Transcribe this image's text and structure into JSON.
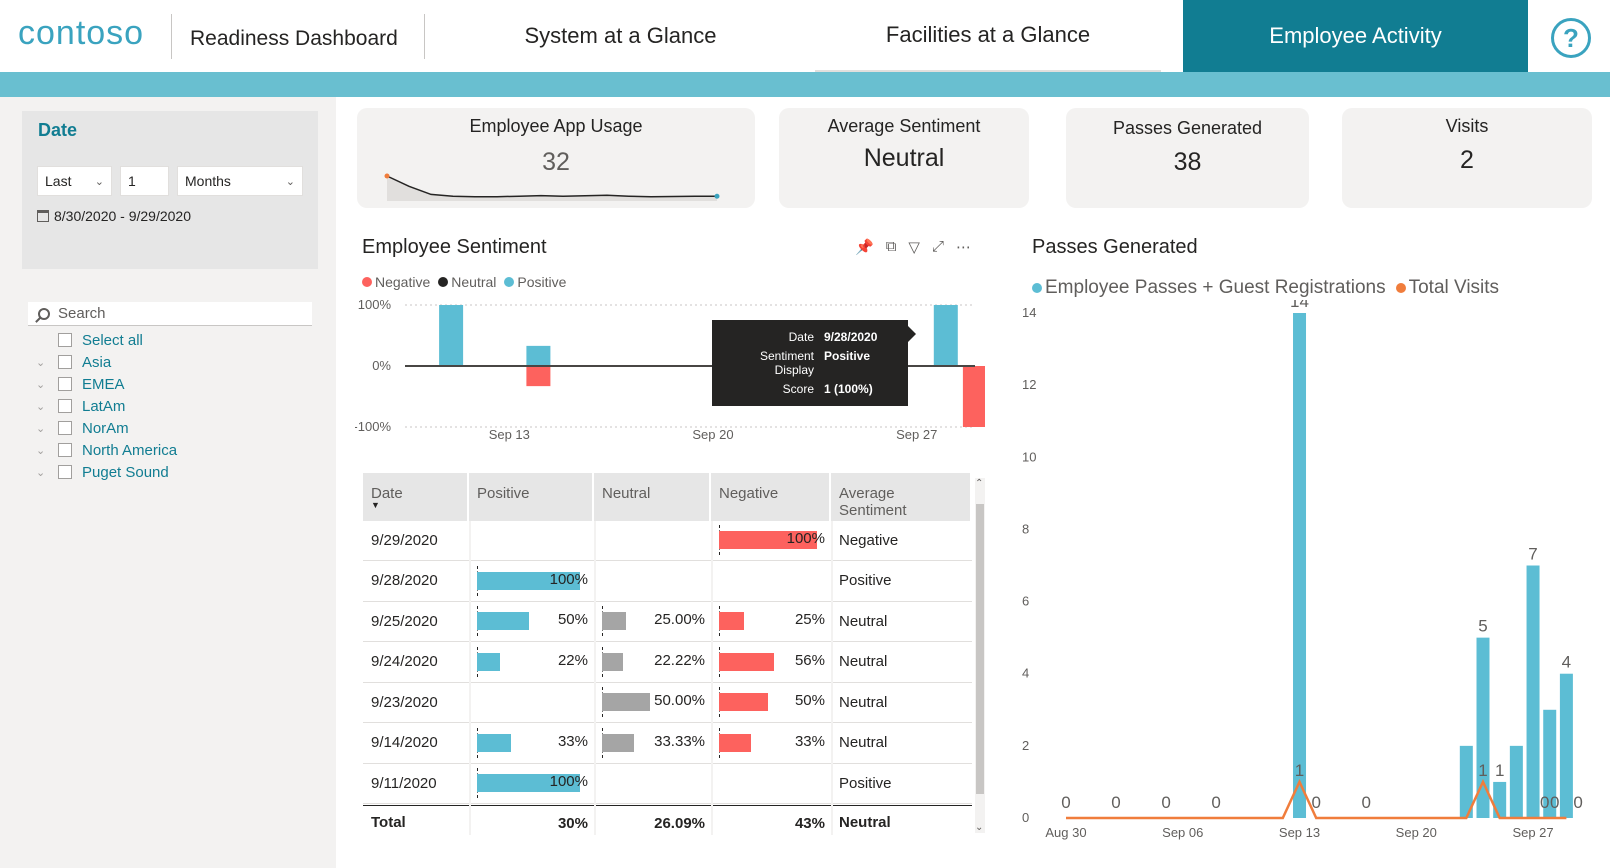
{
  "header": {
    "logo": "contoso",
    "app_title": "Readiness Dashboard",
    "tabs": [
      {
        "label": "System at a Glance",
        "active": false
      },
      {
        "label": "Facilities at a Glance",
        "active": false
      },
      {
        "label": "Employee Activity",
        "active": true
      }
    ],
    "help_icon": "?"
  },
  "date_slicer": {
    "title": "Date",
    "period_relation": "Last",
    "period_count": "1",
    "period_unit": "Months",
    "range": "8/30/2020 - 9/29/2020"
  },
  "region_slicer": {
    "search_placeholder": "Search",
    "items": [
      "Select all",
      "Asia",
      "EMEA",
      "LatAm",
      "NorAm",
      "North America",
      "Puget Sound"
    ]
  },
  "kpis": [
    {
      "title": "Employee App Usage",
      "value": "32"
    },
    {
      "title": "Average Sentiment",
      "value": "Neutral"
    },
    {
      "title": "Passes Generated",
      "value": "38"
    },
    {
      "title": "Visits",
      "value": "2"
    }
  ],
  "app_usage_sparkline": [
    1.0,
    0.55,
    0.2,
    0.12,
    0.1,
    0.1,
    0.12,
    0.15,
    0.12,
    0.14,
    0.16,
    0.12,
    0.1,
    0.11,
    0.12,
    0.12
  ],
  "colors": {
    "positive": "#5cbdd4",
    "negative": "#fd625e",
    "neutral": "#a5a5a5",
    "visits": "#f07d3c",
    "accent": "#117d92"
  },
  "sentiment_chart": {
    "title": "Employee Sentiment",
    "legend": [
      "Negative",
      "Neutral",
      "Positive"
    ],
    "y_ticks": [
      "100%",
      "0%",
      "-100%"
    ],
    "x_ticks": [
      "Sep 13",
      "Sep 20",
      "Sep 27"
    ],
    "tooltip": {
      "date_label": "Date",
      "date": "9/28/2020",
      "display_label": "Sentiment Display",
      "display": "Positive",
      "score_label": "Score",
      "score": "1 (100%)"
    }
  },
  "sentiment_table": {
    "columns": [
      "Date",
      "Positive",
      "Neutral",
      "Negative",
      "Average Sentiment"
    ],
    "rows": [
      {
        "date": "9/29/2020",
        "pos": null,
        "pos_label": "",
        "neu": null,
        "neu_label": "",
        "neg": 1.0,
        "neg_label": "100%",
        "avg": "Negative"
      },
      {
        "date": "9/28/2020",
        "pos": 1.0,
        "pos_label": "100%",
        "neu": null,
        "neu_label": "",
        "neg": null,
        "neg_label": "",
        "avg": "Positive"
      },
      {
        "date": "9/25/2020",
        "pos": 0.5,
        "pos_label": "50%",
        "neu": 0.25,
        "neu_label": "25.00%",
        "neg": 0.25,
        "neg_label": "25%",
        "avg": "Neutral"
      },
      {
        "date": "9/24/2020",
        "pos": 0.22,
        "pos_label": "22%",
        "neu": 0.2222,
        "neu_label": "22.22%",
        "neg": 0.56,
        "neg_label": "56%",
        "avg": "Neutral"
      },
      {
        "date": "9/23/2020",
        "pos": null,
        "pos_label": "",
        "neu": 0.5,
        "neu_label": "50.00%",
        "neg": 0.5,
        "neg_label": "50%",
        "avg": "Neutral"
      },
      {
        "date": "9/14/2020",
        "pos": 0.33,
        "pos_label": "33%",
        "neu": 0.3333,
        "neu_label": "33.33%",
        "neg": 0.33,
        "neg_label": "33%",
        "avg": "Neutral"
      },
      {
        "date": "9/11/2020",
        "pos": 1.0,
        "pos_label": "100%",
        "neu": null,
        "neu_label": "",
        "neg": null,
        "neg_label": "",
        "avg": "Positive"
      }
    ],
    "total": {
      "label": "Total",
      "pos": "30%",
      "neu": "26.09%",
      "neg": "43%",
      "avg": "Neutral"
    }
  },
  "chart_data": [
    {
      "type": "bar",
      "title": "Employee Sentiment",
      "legend": [
        "Negative",
        "Neutral",
        "Positive"
      ],
      "x_ticks": [
        "Sep 13",
        "Sep 20",
        "Sep 27"
      ],
      "ylim": [
        -1,
        1
      ],
      "series": [
        {
          "name": "Positive",
          "points": [
            {
              "day": 11,
              "value": 1.0
            },
            {
              "day": 14,
              "value": 0.33
            },
            {
              "day": 28,
              "value": 1.0
            }
          ]
        },
        {
          "name": "Negative",
          "points": [
            {
              "day": 14,
              "value": -0.33
            },
            {
              "day": 24,
              "value": -0.56
            },
            {
              "day": 25,
              "value": -0.25
            },
            {
              "day": 29,
              "value": -1.0
            }
          ]
        }
      ]
    },
    {
      "type": "bar",
      "title": "Passes Generated",
      "x_ticks": [
        "Aug 30",
        "Sep 06",
        "Sep 13",
        "Sep 20",
        "Sep 27"
      ],
      "y_ticks": [
        0,
        2,
        4,
        6,
        8,
        10,
        12,
        14
      ],
      "ylim": [
        0,
        14
      ],
      "series": [
        {
          "name": "Employee Passes + Guest Registrations",
          "values": [
            0,
            0,
            0,
            0,
            0,
            0,
            0,
            0,
            0,
            0,
            0,
            0,
            0,
            0,
            14,
            0,
            0,
            0,
            0,
            0,
            0,
            0,
            0,
            0,
            2,
            5,
            1,
            2,
            7,
            3,
            4
          ]
        },
        {
          "name": "Total Visits",
          "values": [
            0,
            0,
            0,
            0,
            0,
            0,
            0,
            0,
            0,
            0,
            0,
            0,
            0,
            0,
            1,
            0,
            0,
            0,
            0,
            0,
            0,
            0,
            0,
            0,
            0,
            1,
            0,
            0,
            0,
            0,
            0
          ]
        }
      ],
      "data_labels": [
        {
          "day": 0,
          "text": "0"
        },
        {
          "day": 3,
          "text": "0"
        },
        {
          "day": 6,
          "text": "0"
        },
        {
          "day": 9,
          "text": "0"
        },
        {
          "day": 14,
          "text": "14"
        },
        {
          "day": 14,
          "text": "1"
        },
        {
          "day": 15,
          "text": "0"
        },
        {
          "day": 18,
          "text": "0"
        },
        {
          "day": 25,
          "text": "5"
        },
        {
          "day": 25,
          "text": "1"
        },
        {
          "day": 26,
          "text": "1"
        },
        {
          "day": 28,
          "text": "7"
        },
        {
          "day": 28.7,
          "text": "0"
        },
        {
          "day": 29.3,
          "text": "0"
        },
        {
          "day": 30,
          "text": "4"
        },
        {
          "day": 30.7,
          "text": "0"
        }
      ]
    }
  ]
}
